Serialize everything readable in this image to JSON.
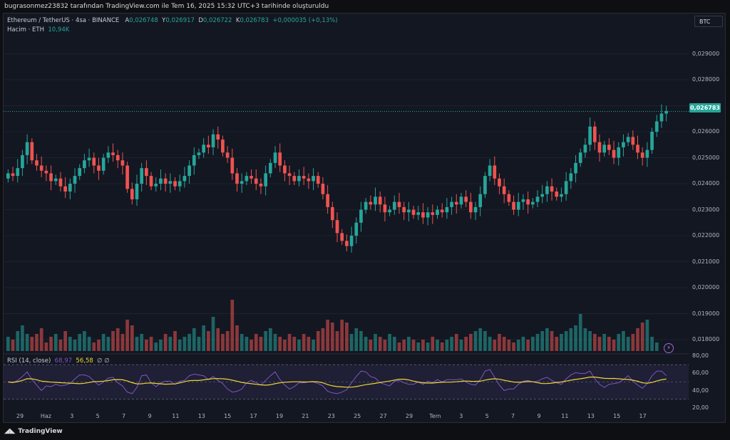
{
  "header": {
    "created_by": "bugrasonmez23832 tarafından TradingView.com ile Tem 16, 2025 15:32 UTC+3 tarihinde oluşturuldu"
  },
  "legend": {
    "symbol": "Ethereum / TetherUS · 4sa · BINANCE",
    "ohlc": [
      {
        "k": "A",
        "v": "0,026748"
      },
      {
        "k": "Y",
        "v": "0,026917"
      },
      {
        "k": "D",
        "v": "0,026722"
      },
      {
        "k": "K",
        "v": "0,026783"
      }
    ],
    "change": "+0,000035 (+0,13%)",
    "volume_label": "Hacim · ETH",
    "volume_value": "10,94K"
  },
  "toolbar": {
    "currency_button": "BTC"
  },
  "last_price": "0,026783",
  "rsi": {
    "label": "RSI (14, close)",
    "rsi_value": "68,97",
    "ma_value": "56,58",
    "extra": "∅  ∅"
  },
  "footer": {
    "brand": "TradingView"
  },
  "colors": {
    "up": "#26a69a",
    "down": "#ef5350",
    "rsi": "#7e57c2",
    "rsi_ma": "#f0d535",
    "background": "#131722"
  },
  "chart_data": {
    "type": "candlestick",
    "price_axis_ticks": [
      "0,029000",
      "0,028000",
      "0,027000",
      "0,026000",
      "0,025000",
      "0,024000",
      "0,023000",
      "0,022000",
      "0,021000",
      "0,020000",
      "0,019000",
      "0,018000"
    ],
    "rsi_axis_ticks": [
      "80,00",
      "60,00",
      "40,00",
      "20,00"
    ],
    "date_ticks": [
      "29",
      "Haz",
      "3",
      "5",
      "7",
      "9",
      "11",
      "13",
      "15",
      "17",
      "19",
      "21",
      "23",
      "25",
      "27",
      "29",
      "Tem",
      "3",
      "5",
      "7",
      "9",
      "11",
      "13",
      "15",
      "17"
    ],
    "y_range": [
      0.0177,
      0.0297
    ],
    "rsi_range": [
      20,
      80
    ],
    "closes": [
      0.0244,
      0.0243,
      0.0246,
      0.0251,
      0.0256,
      0.0249,
      0.0247,
      0.0245,
      0.0244,
      0.0241,
      0.0242,
      0.0239,
      0.0237,
      0.024,
      0.0243,
      0.0246,
      0.0249,
      0.025,
      0.0247,
      0.0245,
      0.025,
      0.0252,
      0.0251,
      0.0249,
      0.0247,
      0.0238,
      0.0234,
      0.024,
      0.0246,
      0.0243,
      0.0239,
      0.024,
      0.0242,
      0.024,
      0.0241,
      0.0239,
      0.0241,
      0.0243,
      0.0247,
      0.0251,
      0.0252,
      0.0255,
      0.0254,
      0.0259,
      0.0257,
      0.0252,
      0.025,
      0.0244,
      0.024,
      0.0241,
      0.0243,
      0.0242,
      0.024,
      0.0239,
      0.0244,
      0.0248,
      0.0252,
      0.0247,
      0.0244,
      0.0243,
      0.0241,
      0.0243,
      0.0242,
      0.0241,
      0.0243,
      0.024,
      0.0236,
      0.0231,
      0.0226,
      0.0221,
      0.0218,
      0.0216,
      0.022,
      0.0225,
      0.023,
      0.0233,
      0.0232,
      0.0235,
      0.0232,
      0.0229,
      0.023,
      0.0233,
      0.0231,
      0.0229,
      0.023,
      0.0228,
      0.0229,
      0.0227,
      0.0229,
      0.0228,
      0.023,
      0.0229,
      0.0231,
      0.0233,
      0.0232,
      0.0235,
      0.0233,
      0.0229,
      0.0231,
      0.0236,
      0.0243,
      0.0247,
      0.0242,
      0.0239,
      0.0236,
      0.0233,
      0.023,
      0.0233,
      0.0234,
      0.0232,
      0.0233,
      0.0235,
      0.0236,
      0.0239,
      0.0237,
      0.0235,
      0.0236,
      0.0241,
      0.0244,
      0.0248,
      0.0252,
      0.0255,
      0.0262,
      0.0256,
      0.0252,
      0.0255,
      0.0253,
      0.025,
      0.0254,
      0.0256,
      0.0258,
      0.0255,
      0.0252,
      0.025,
      0.0253,
      0.026,
      0.0264,
      0.0267,
      0.0268
    ],
    "volumes": [
      0.5,
      0.4,
      0.7,
      0.9,
      0.6,
      0.5,
      0.6,
      0.8,
      0.3,
      0.5,
      0.6,
      0.4,
      0.7,
      0.5,
      0.4,
      0.6,
      0.7,
      0.5,
      0.3,
      0.4,
      0.6,
      0.5,
      0.7,
      0.8,
      0.6,
      1.1,
      0.9,
      0.5,
      0.6,
      0.4,
      0.5,
      0.3,
      0.4,
      0.6,
      0.5,
      0.7,
      0.4,
      0.5,
      0.6,
      0.8,
      0.5,
      0.9,
      0.7,
      1.2,
      0.8,
      0.6,
      0.7,
      1.8,
      0.9,
      0.6,
      0.5,
      0.4,
      0.6,
      0.5,
      0.7,
      0.8,
      0.6,
      0.5,
      0.4,
      0.6,
      0.5,
      0.4,
      0.6,
      0.5,
      0.4,
      0.7,
      0.8,
      1.1,
      1.0,
      0.7,
      1.1,
      1.0,
      0.6,
      0.8,
      0.7,
      0.5,
      0.4,
      0.6,
      0.5,
      0.4,
      0.6,
      0.5,
      0.3,
      0.4,
      0.5,
      0.4,
      0.3,
      0.4,
      0.3,
      0.5,
      0.4,
      0.3,
      0.4,
      0.5,
      0.6,
      0.4,
      0.5,
      0.6,
      0.7,
      0.8,
      0.7,
      0.5,
      0.4,
      0.6,
      0.5,
      0.4,
      0.3,
      0.4,
      0.5,
      0.4,
      0.5,
      0.6,
      0.7,
      0.8,
      0.7,
      0.5,
      0.6,
      0.7,
      0.8,
      0.9,
      1.3,
      0.8,
      0.7,
      0.6,
      0.5,
      0.6,
      0.5,
      0.4,
      0.6,
      0.7,
      0.5,
      0.6,
      0.8,
      1.0,
      1.1,
      0.5,
      0.3
    ]
  }
}
